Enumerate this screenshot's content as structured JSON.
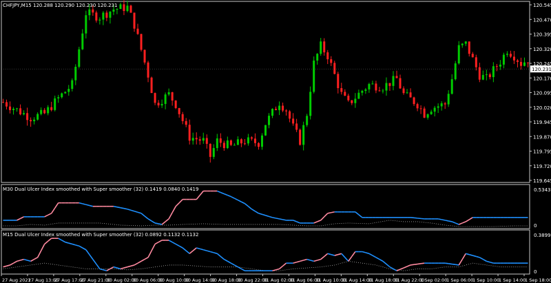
{
  "header": {
    "symbol": "CHFJPY,M15",
    "quotes": "120.288 120.290 120.230 120.231"
  },
  "colors": {
    "background": "#000000",
    "bull": "#00cc00",
    "bear": "#ff2020",
    "line_up": "#1e90ff",
    "line_down": "#ff8aa0",
    "dots": "#b0b0b0",
    "frame": "#c8c8c8",
    "price_tag_bg": "#ffffff"
  },
  "price_axis": {
    "ticks": [
      "120.545",
      "120.470",
      "120.395",
      "120.320",
      "120.245",
      "120.170",
      "120.095",
      "120.020",
      "119.945",
      "119.870",
      "119.795",
      "119.720",
      "119.645"
    ],
    "current_tag": "120.231"
  },
  "panel1": {
    "label": "M30 Dual Ulcer Index smoothed with Super smoother (32) 0.1419 0.0840 0.1419",
    "axis_max": "0.5343",
    "axis_min": "0"
  },
  "panel2": {
    "label": "M15 Dual Ulcer Index smoothed with Super smoother (32) 0.0892 0.1132 0.1132",
    "axis_max": "0.3899",
    "axis_min": "0"
  },
  "time_axis": {
    "ticks": [
      "27 Aug 2021",
      "27 Aug 13:00",
      "27 Aug 17:00",
      "27 Aug 21:00",
      "30 Aug 02:00",
      "30 Aug 06:00",
      "30 Aug 10:00",
      "30 Aug 14:00",
      "30 Aug 18:00",
      "30 Aug 22:00",
      "31 Aug 02:00",
      "31 Aug 06:00",
      "31 Aug 10:00",
      "31 Aug 14:00",
      "31 Aug 18:00",
      "31 Aug 22:00",
      "1 Sep 02:00",
      "1 Sep 06:00",
      "1 Sep 10:00",
      "1 Sep 14:00",
      "1 Sep 18:00"
    ]
  },
  "chart_data": {
    "type": "candlestick",
    "price_path": [
      [
        0,
        120.06
      ],
      [
        4,
        120.02
      ],
      [
        8,
        119.98
      ],
      [
        12,
        120.0
      ],
      [
        16,
        120.08
      ],
      [
        20,
        120.15
      ],
      [
        24,
        120.52
      ],
      [
        28,
        120.5
      ],
      [
        32,
        120.54
      ],
      [
        36,
        120.55
      ],
      [
        38,
        120.46
      ],
      [
        42,
        120.2
      ],
      [
        44,
        120.05
      ],
      [
        48,
        120.1
      ],
      [
        50,
        120.05
      ],
      [
        54,
        119.88
      ],
      [
        58,
        119.86
      ],
      [
        60,
        119.78
      ],
      [
        62,
        119.86
      ],
      [
        66,
        119.83
      ],
      [
        70,
        119.86
      ],
      [
        74,
        119.85
      ],
      [
        76,
        119.95
      ],
      [
        80,
        120.06
      ],
      [
        82,
        120.02
      ],
      [
        84,
        119.93
      ],
      [
        86,
        119.86
      ],
      [
        88,
        120.0
      ],
      [
        90,
        120.26
      ],
      [
        92,
        120.35
      ],
      [
        94,
        120.3
      ],
      [
        96,
        120.2
      ],
      [
        98,
        120.1
      ],
      [
        100,
        120.05
      ],
      [
        104,
        120.12
      ],
      [
        106,
        120.15
      ],
      [
        110,
        120.14
      ],
      [
        114,
        120.18
      ],
      [
        116,
        120.1
      ],
      [
        120,
        120.05
      ],
      [
        122,
        120.0
      ],
      [
        124,
        120.03
      ],
      [
        128,
        120.05
      ],
      [
        130,
        120.18
      ],
      [
        132,
        120.34
      ],
      [
        134,
        120.36
      ],
      [
        136,
        120.28
      ],
      [
        138,
        120.2
      ],
      [
        140,
        120.18
      ],
      [
        144,
        120.27
      ],
      [
        146,
        120.33
      ],
      [
        148,
        120.3
      ],
      [
        150,
        120.26
      ],
      [
        152,
        120.28
      ]
    ],
    "series": [
      {
        "name": "M30 Dual Ulcer Index",
        "points": [
          [
            0,
            0.1
          ],
          [
            2,
            0.1
          ],
          [
            4,
            0.1
          ],
          [
            6,
            0.15
          ],
          [
            12,
            0.15
          ],
          [
            14,
            0.2
          ],
          [
            16,
            0.35
          ],
          [
            22,
            0.35
          ],
          [
            26,
            0.3
          ],
          [
            32,
            0.3
          ],
          [
            36,
            0.26
          ],
          [
            40,
            0.2
          ],
          [
            42,
            0.12
          ],
          [
            44,
            0.06
          ],
          [
            46,
            0.04
          ],
          [
            48,
            0.12
          ],
          [
            50,
            0.3
          ],
          [
            52,
            0.4
          ],
          [
            56,
            0.4
          ],
          [
            58,
            0.52
          ],
          [
            62,
            0.52
          ],
          [
            66,
            0.44
          ],
          [
            70,
            0.34
          ],
          [
            72,
            0.26
          ],
          [
            74,
            0.2
          ],
          [
            78,
            0.14
          ],
          [
            82,
            0.1
          ],
          [
            84,
            0.1
          ],
          [
            86,
            0.06
          ],
          [
            90,
            0.06
          ],
          [
            92,
            0.1
          ],
          [
            94,
            0.2
          ],
          [
            96,
            0.22
          ],
          [
            102,
            0.22
          ],
          [
            104,
            0.14
          ],
          [
            108,
            0.14
          ],
          [
            114,
            0.14
          ],
          [
            118,
            0.14
          ],
          [
            122,
            0.12
          ],
          [
            126,
            0.12
          ],
          [
            130,
            0.08
          ],
          [
            132,
            0.04
          ],
          [
            134,
            0.08
          ],
          [
            136,
            0.14
          ],
          [
            140,
            0.14
          ],
          [
            148,
            0.14
          ],
          [
            152,
            0.14
          ]
        ]
      },
      {
        "name": "M30 dotted",
        "points": [
          [
            0,
            0.02
          ],
          [
            4,
            0.02
          ],
          [
            8,
            0.04
          ],
          [
            12,
            0.03
          ],
          [
            16,
            0.06
          ],
          [
            20,
            0.06
          ],
          [
            28,
            0.06
          ],
          [
            34,
            0.03
          ],
          [
            40,
            0.02
          ],
          [
            44,
            0.03
          ],
          [
            48,
            0.03
          ],
          [
            52,
            0.04
          ],
          [
            58,
            0.05
          ],
          [
            64,
            0.04
          ],
          [
            70,
            0.04
          ],
          [
            74,
            0.04
          ],
          [
            80,
            0.04
          ],
          [
            84,
            0.03
          ],
          [
            88,
            0.02
          ],
          [
            92,
            0.02
          ],
          [
            96,
            0.05
          ],
          [
            100,
            0.06
          ],
          [
            106,
            0.05
          ],
          [
            112,
            0.1
          ],
          [
            116,
            0.08
          ],
          [
            120,
            0.08
          ],
          [
            124,
            0.06
          ],
          [
            128,
            0.03
          ],
          [
            132,
            0.01
          ],
          [
            136,
            0.01
          ],
          [
            142,
            0.01
          ],
          [
            148,
            0.02
          ],
          [
            152,
            0.02
          ]
        ]
      },
      {
        "name": "M15 Dual Ulcer Index",
        "points": [
          [
            0,
            0.06
          ],
          [
            2,
            0.08
          ],
          [
            4,
            0.12
          ],
          [
            6,
            0.14
          ],
          [
            8,
            0.12
          ],
          [
            10,
            0.16
          ],
          [
            12,
            0.3
          ],
          [
            14,
            0.36
          ],
          [
            16,
            0.36
          ],
          [
            18,
            0.32
          ],
          [
            20,
            0.3
          ],
          [
            22,
            0.28
          ],
          [
            24,
            0.24
          ],
          [
            26,
            0.14
          ],
          [
            28,
            0.04
          ],
          [
            30,
            0.02
          ],
          [
            32,
            0.06
          ],
          [
            34,
            0.04
          ],
          [
            36,
            0.06
          ],
          [
            38,
            0.08
          ],
          [
            40,
            0.12
          ],
          [
            42,
            0.16
          ],
          [
            44,
            0.3
          ],
          [
            46,
            0.34
          ],
          [
            48,
            0.34
          ],
          [
            50,
            0.3
          ],
          [
            52,
            0.26
          ],
          [
            54,
            0.2
          ],
          [
            56,
            0.26
          ],
          [
            58,
            0.24
          ],
          [
            60,
            0.22
          ],
          [
            62,
            0.2
          ],
          [
            64,
            0.14
          ],
          [
            66,
            0.1
          ],
          [
            68,
            0.06
          ],
          [
            70,
            0.02
          ],
          [
            74,
            0.02
          ],
          [
            78,
            0.02
          ],
          [
            80,
            0.04
          ],
          [
            82,
            0.1
          ],
          [
            84,
            0.1
          ],
          [
            86,
            0.12
          ],
          [
            88,
            0.14
          ],
          [
            90,
            0.12
          ],
          [
            92,
            0.14
          ],
          [
            94,
            0.2
          ],
          [
            96,
            0.18
          ],
          [
            98,
            0.2
          ],
          [
            100,
            0.12
          ],
          [
            102,
            0.22
          ],
          [
            104,
            0.22
          ],
          [
            106,
            0.2
          ],
          [
            108,
            0.16
          ],
          [
            110,
            0.12
          ],
          [
            112,
            0.06
          ],
          [
            114,
            0.02
          ],
          [
            118,
            0.08
          ],
          [
            122,
            0.1
          ],
          [
            128,
            0.1
          ],
          [
            132,
            0.08
          ],
          [
            134,
            0.2
          ],
          [
            136,
            0.18
          ],
          [
            138,
            0.16
          ],
          [
            140,
            0.12
          ],
          [
            142,
            0.1
          ],
          [
            146,
            0.1
          ],
          [
            152,
            0.1
          ]
        ]
      },
      {
        "name": "M15 dotted",
        "points": [
          [
            0,
            0.04
          ],
          [
            4,
            0.06
          ],
          [
            8,
            0.08
          ],
          [
            12,
            0.1
          ],
          [
            16,
            0.08
          ],
          [
            20,
            0.06
          ],
          [
            24,
            0.04
          ],
          [
            28,
            0.04
          ],
          [
            32,
            0.04
          ],
          [
            36,
            0.03
          ],
          [
            40,
            0.04
          ],
          [
            44,
            0.06
          ],
          [
            48,
            0.08
          ],
          [
            52,
            0.08
          ],
          [
            56,
            0.07
          ],
          [
            60,
            0.06
          ],
          [
            64,
            0.06
          ],
          [
            68,
            0.06
          ],
          [
            72,
            0.04
          ],
          [
            76,
            0.02
          ],
          [
            80,
            0.02
          ],
          [
            84,
            0.04
          ],
          [
            88,
            0.05
          ],
          [
            92,
            0.06
          ],
          [
            96,
            0.08
          ],
          [
            100,
            0.12
          ],
          [
            104,
            0.1
          ],
          [
            108,
            0.08
          ],
          [
            112,
            0.04
          ],
          [
            116,
            0.02
          ],
          [
            120,
            0.04
          ],
          [
            124,
            0.04
          ],
          [
            128,
            0.06
          ],
          [
            132,
            0.06
          ],
          [
            136,
            0.1
          ],
          [
            140,
            0.08
          ],
          [
            144,
            0.06
          ],
          [
            148,
            0.06
          ],
          [
            152,
            0.06
          ]
        ]
      }
    ],
    "ylim_price": [
      119.645,
      120.58
    ],
    "ylim_panel1": [
      0,
      0.5343
    ],
    "ylim_panel2": [
      0,
      0.3899
    ]
  }
}
